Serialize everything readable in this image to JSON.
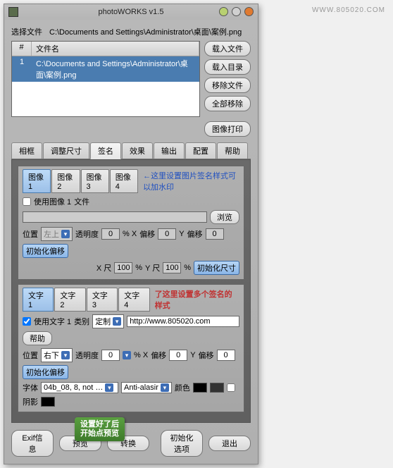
{
  "window": {
    "title": "photoWORKS v1.5"
  },
  "pathRow": {
    "label": "选择文件",
    "path": "C:\\Documents and Settings\\Administrator\\桌面\\案例.png"
  },
  "fileList": {
    "headers": {
      "num": "#",
      "name": "文件名"
    },
    "rows": [
      {
        "num": "1",
        "name": "C:\\Documents and Settings\\Administrator\\桌面\\案例.png"
      }
    ]
  },
  "sideButtons": {
    "loadFile": "载入文件",
    "loadDir": "载入目录",
    "removeFile": "移除文件",
    "removeAll": "全部移除",
    "printImage": "图像打印"
  },
  "mainTabs": {
    "frame": "相框",
    "resize": "调整尺寸",
    "sign": "签名",
    "effect": "效果",
    "output": "输出",
    "config": "配置",
    "help": "帮助"
  },
  "imageTabs": {
    "t1": "图像 1",
    "t2": "图像 2",
    "t3": "图像 3",
    "t4": "图像 4",
    "hint": "←这里设置图片签名样式可以加水印"
  },
  "imageSection": {
    "useImageLabel": "使用图像 1",
    "fileLabel": "文件",
    "browse": "浏览",
    "posLabel": "位置",
    "posValue": "左上",
    "opacityLabel": "透明度",
    "opacityValue": "0",
    "pctX": "% X",
    "offsetLabel": "偏移",
    "xOffset": "0",
    "yLabel": "Y",
    "yOffset": "0",
    "initOffset": "初始化偏移",
    "xScaleLabel": "X 尺",
    "xScale": "100",
    "yScaleLabel": "Y 尺",
    "yScale": "100",
    "pct": "%",
    "initSize": "初始化尺寸"
  },
  "textTabs": {
    "t1": "文字 1",
    "t2": "文字 2",
    "t3": "文字 3",
    "t4": "文字 4",
    "hint": "了这里设置多个签名的样式"
  },
  "textSection": {
    "useTextLabel": "使用文字 1",
    "kindLabel": "类别",
    "kindValue": "定制",
    "urlValue": "http://www.805020.com",
    "help": "帮助",
    "posLabel": "位置",
    "posValue": "右下",
    "opacityLabel": "透明度",
    "opacityValue": "0",
    "pctX": "% X",
    "offsetLabel": "偏移",
    "xOffset": "0",
    "yLabel": "Y",
    "yOffset": "0",
    "initOffset": "初始化偏移",
    "fontLabel": "字体",
    "fontValue": "04b_08, 8, not …",
    "antiLabel": "Anti-alasir",
    "colorLabel": "颜色",
    "shadowLabel": "阴影"
  },
  "callout": {
    "l1": "设置好了后",
    "l2": "开始点预览"
  },
  "bottom": {
    "exif": "Exif信息",
    "preview": "预览",
    "convert": "转换",
    "initOptions": "初始化选项",
    "exit": "退出"
  },
  "watermark": "WWW.805020.COM"
}
